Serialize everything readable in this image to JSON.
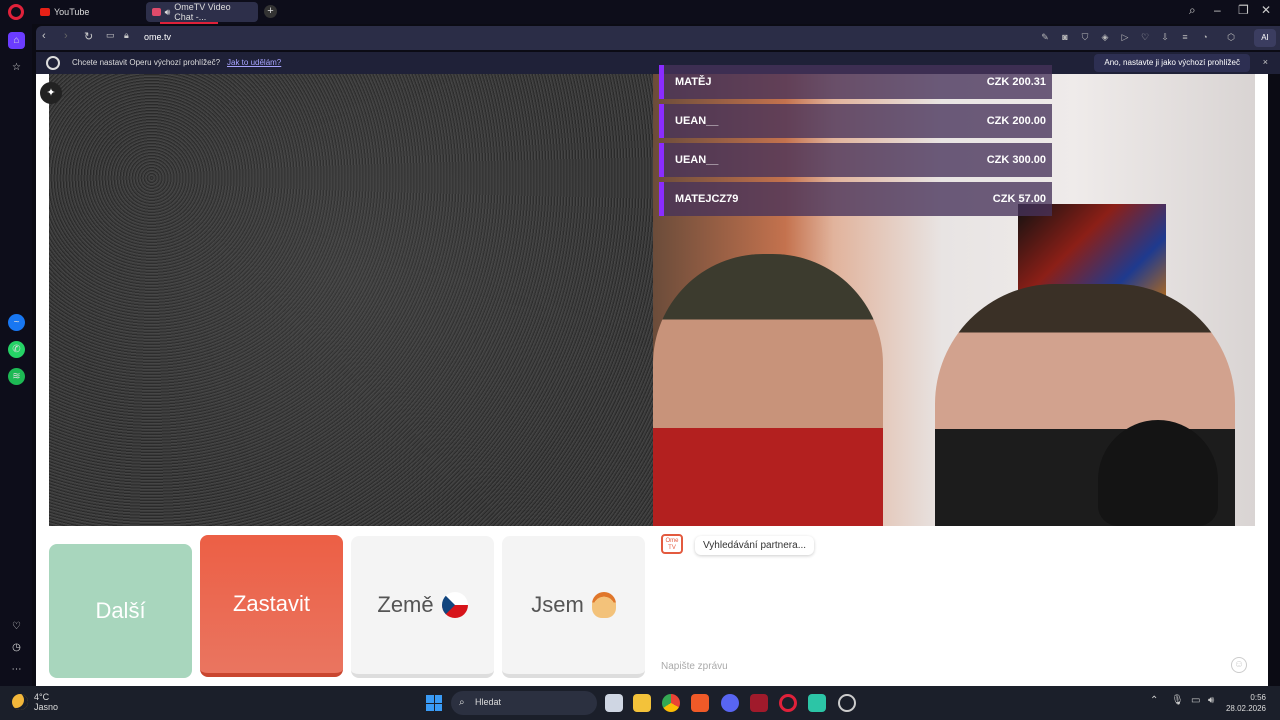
{
  "browser": {
    "tabs": [
      {
        "label": "YouTube"
      },
      {
        "label": "OmeTV Video Chat -..."
      }
    ],
    "url": "ome.tv",
    "infobar": {
      "question": "Chcete nastavit Operu výchozí prohlížeč?",
      "link": "Jak to udělám?",
      "accept": "Ano, nastavte ji jako výchozí prohlížeč",
      "close": "×"
    },
    "ai_label": "AI"
  },
  "donations": [
    {
      "name": "MATĚJ",
      "amount": "CZK 200.31"
    },
    {
      "name": "UEAN__",
      "amount": "CZK 200.00"
    },
    {
      "name": "UEAN__",
      "amount": "CZK 300.00"
    },
    {
      "name": "MATEJCZ79",
      "amount": "CZK 57.00"
    }
  ],
  "controls": {
    "next": "Další",
    "stop": "Zastavit",
    "country": "Země",
    "iam": "Jsem"
  },
  "chat": {
    "logo": "Ome TV",
    "status": "Vyhledávání partnera...",
    "placeholder": "Napište zprávu"
  },
  "taskbar": {
    "temperature": "4°C",
    "weather": "Jasno",
    "search": "Hledat",
    "time": "0:56",
    "date": "28.02.2026"
  }
}
